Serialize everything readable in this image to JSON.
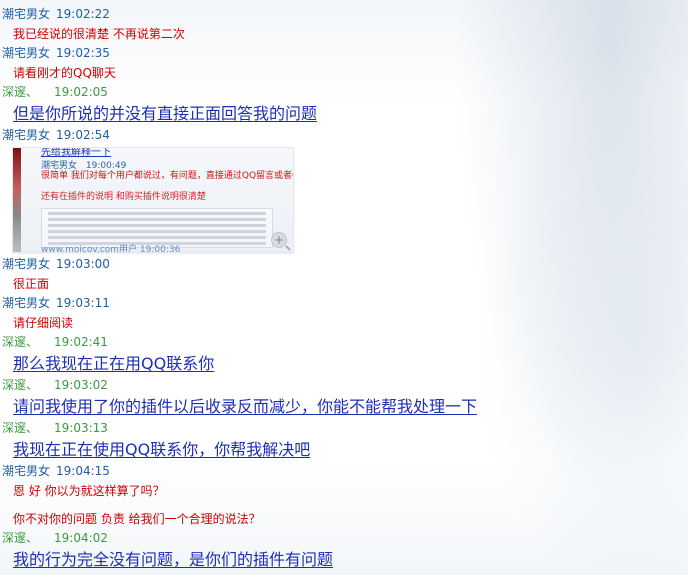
{
  "chat": {
    "messages": [
      {
        "sender": "潮宅男女",
        "time": "19:02:22",
        "text": "我已经说的很清楚 不再说第二次",
        "style": "red"
      },
      {
        "sender": "潮宅男女",
        "time": "19:02:35",
        "text": "请看刚才的QQ聊天",
        "style": "red"
      },
      {
        "sender": "深邃、",
        "time": "19:02:05",
        "text": "但是你所说的并没有直接正面回答我的问题",
        "style": "link"
      },
      {
        "sender": "潮宅男女",
        "time": "19:02:54",
        "style": "image"
      },
      {
        "sender": "潮宅男女",
        "time": "19:03:00",
        "text": "很正面",
        "style": "red"
      },
      {
        "sender": "潮宅男女",
        "time": "19:03:11",
        "text": "请仔细阅读",
        "style": "red"
      },
      {
        "sender": "深邃、",
        "time": "19:02:41",
        "text": "那么我现在正在用QQ联系你",
        "style": "link"
      },
      {
        "sender": "深邃、",
        "time": "19:03:02",
        "text": "请问我使用了你的插件以后收录反而减少，你能不能帮我处理一下",
        "style": "link"
      },
      {
        "sender": "深邃、",
        "time": "19:03:13",
        "text": "我现在正在使用QQ联系你，你帮我解决吧",
        "style": "link"
      },
      {
        "sender": "潮宅男女",
        "time": "19:04:15",
        "text": "恩 好  你以为就这样算了吗？",
        "text2": "你不对你的问题 负责 给我们一个合理的说法？",
        "style": "red"
      },
      {
        "sender": "深邃、",
        "time": "19:04:02",
        "text": "我的行为完全没有问题，是你们的插件有问题",
        "style": "link"
      }
    ],
    "image_preview": {
      "title": "先给我解释一下",
      "sender": "潮宅男女",
      "time": "19:00:49",
      "line1": "很简单 我们对每个用户都说过，有问题，直接通过QQ留言或者QQ联系",
      "line2": "还有在插件的说明  和购买插件说明很清楚",
      "bottom": "www.moicov.com用户   19:00:36",
      "zoom_icon": "magnifier-plus-icon"
    },
    "colors": {
      "sender_blue": "#1f5ea8",
      "sender_green": "#3c9a42",
      "text_red": "#d00000",
      "text_link": "#1c2fb5"
    }
  }
}
